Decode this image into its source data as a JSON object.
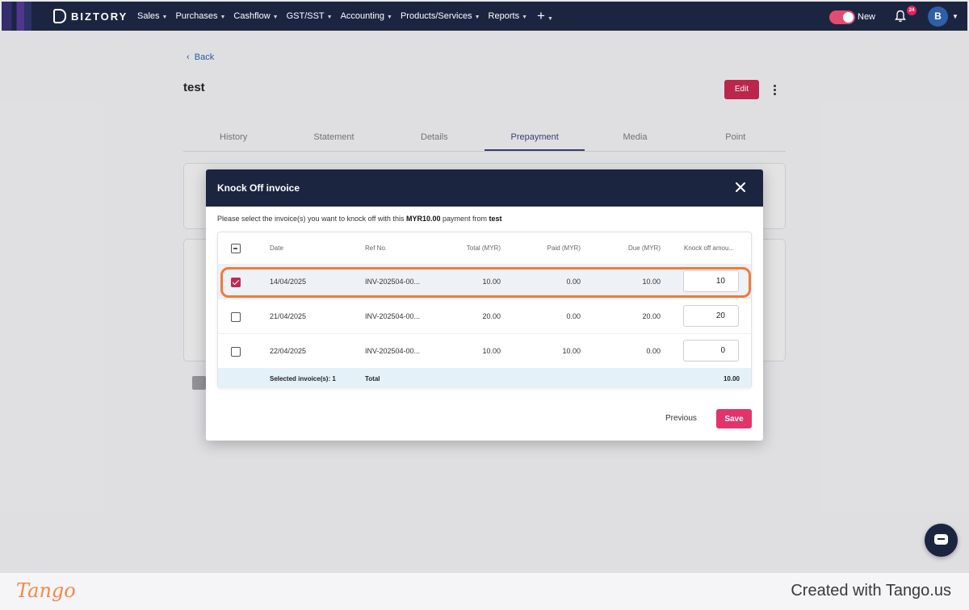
{
  "topbar": {
    "brand": "BIZTORY",
    "nav": [
      "Sales",
      "Purchases",
      "Cashflow",
      "GST/SST",
      "Accounting",
      "Products/Services",
      "Reports"
    ],
    "toggle_label": "New",
    "notification_count": "24",
    "avatar_initial": "B"
  },
  "page": {
    "back_label": "Back",
    "title": "test",
    "edit_label": "Edit",
    "tabs": [
      "History",
      "Statement",
      "Details",
      "Prepayment",
      "Media",
      "Point"
    ],
    "active_tab": "Prepayment"
  },
  "modal": {
    "title": "Knock Off invoice",
    "instruction_prefix": "Please select the invoice(s) you want to knock off with this ",
    "instruction_amount": "MYR10.00",
    "instruction_middle": " payment from ",
    "instruction_customer": "test",
    "columns": [
      "Date",
      "Ref No.",
      "Total (MYR)",
      "Paid (MYR)",
      "Due (MYR)",
      "Knock off amou..."
    ],
    "rows": [
      {
        "date": "14/04/2025",
        "ref": "INV-202504-00...",
        "total": "10.00",
        "paid": "0.00",
        "due": "10.00",
        "knock_off": "10",
        "selected": true
      },
      {
        "date": "21/04/2025",
        "ref": "INV-202504-00...",
        "total": "20.00",
        "paid": "0.00",
        "due": "20.00",
        "knock_off": "20",
        "selected": false
      },
      {
        "date": "22/04/2025",
        "ref": "INV-202504-00...",
        "total": "10.00",
        "paid": "10.00",
        "due": "0.00",
        "knock_off": "0",
        "selected": false
      }
    ],
    "footer": {
      "selected_label": "Selected invoice(s): 1",
      "total_label": "Total",
      "total_value": "10.00"
    },
    "previous_label": "Previous",
    "save_label": "Save"
  },
  "watermark": {
    "logo": "Tango",
    "credit": "Created with Tango.us"
  },
  "colors": {
    "navbar": "#1c2540",
    "accent": "#c2294f",
    "save": "#e2336a",
    "highlight": "#f07a3a"
  }
}
